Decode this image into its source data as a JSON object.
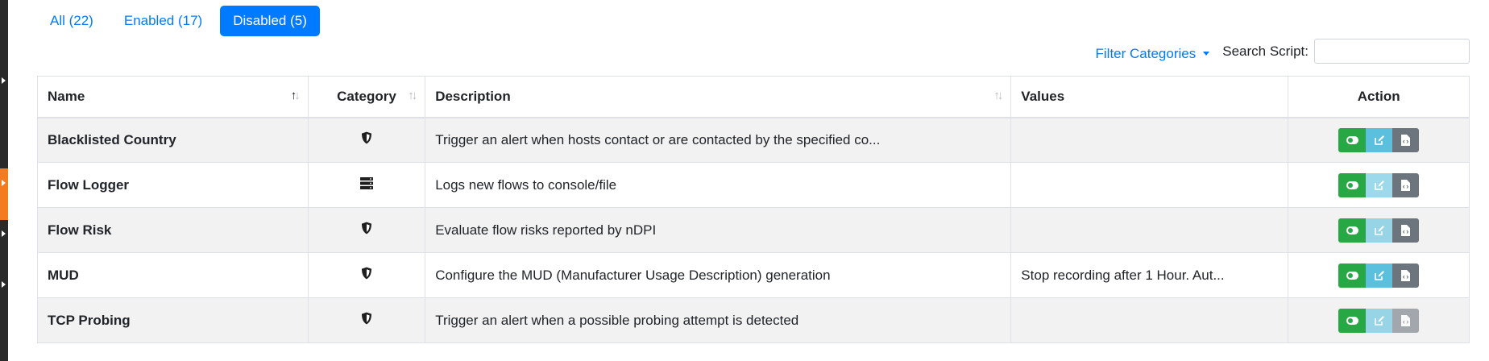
{
  "tabs": [
    {
      "label": "All (22)",
      "active": false
    },
    {
      "label": "Enabled (17)",
      "active": false
    },
    {
      "label": "Disabled (5)",
      "active": true
    }
  ],
  "toolbar": {
    "filter_label": "Filter Categories",
    "search_label": "Search Script:",
    "search_value": ""
  },
  "table": {
    "columns": [
      "Name",
      "Category",
      "Description",
      "Values",
      "Action"
    ],
    "rows": [
      {
        "name": "Blacklisted Country",
        "category_icon": "shield-icon",
        "description": "Trigger an alert when hosts contact or are contacted by the specified co...",
        "values": "",
        "edit_enabled": true,
        "code_enabled": true
      },
      {
        "name": "Flow Logger",
        "category_icon": "server-icon",
        "description": "Logs new flows to console/file",
        "values": "",
        "edit_enabled": false,
        "code_enabled": true
      },
      {
        "name": "Flow Risk",
        "category_icon": "shield-icon",
        "description": "Evaluate flow risks reported by nDPI",
        "values": "",
        "edit_enabled": false,
        "code_enabled": true
      },
      {
        "name": "MUD",
        "category_icon": "shield-icon",
        "description": "Configure the MUD (Manufacturer Usage Description) generation",
        "values": "Stop recording after 1 Hour. Aut...",
        "edit_enabled": true,
        "code_enabled": true
      },
      {
        "name": "TCP Probing",
        "category_icon": "shield-icon",
        "description": "Trigger an alert when a possible probing attempt is detected",
        "values": "",
        "edit_enabled": false,
        "code_enabled": false
      }
    ]
  },
  "colors": {
    "primary": "#007bff",
    "toggle": "#28a745",
    "edit": "#5bc0de",
    "code": "#6c757d",
    "sidebar_accent": "#f47b20"
  }
}
